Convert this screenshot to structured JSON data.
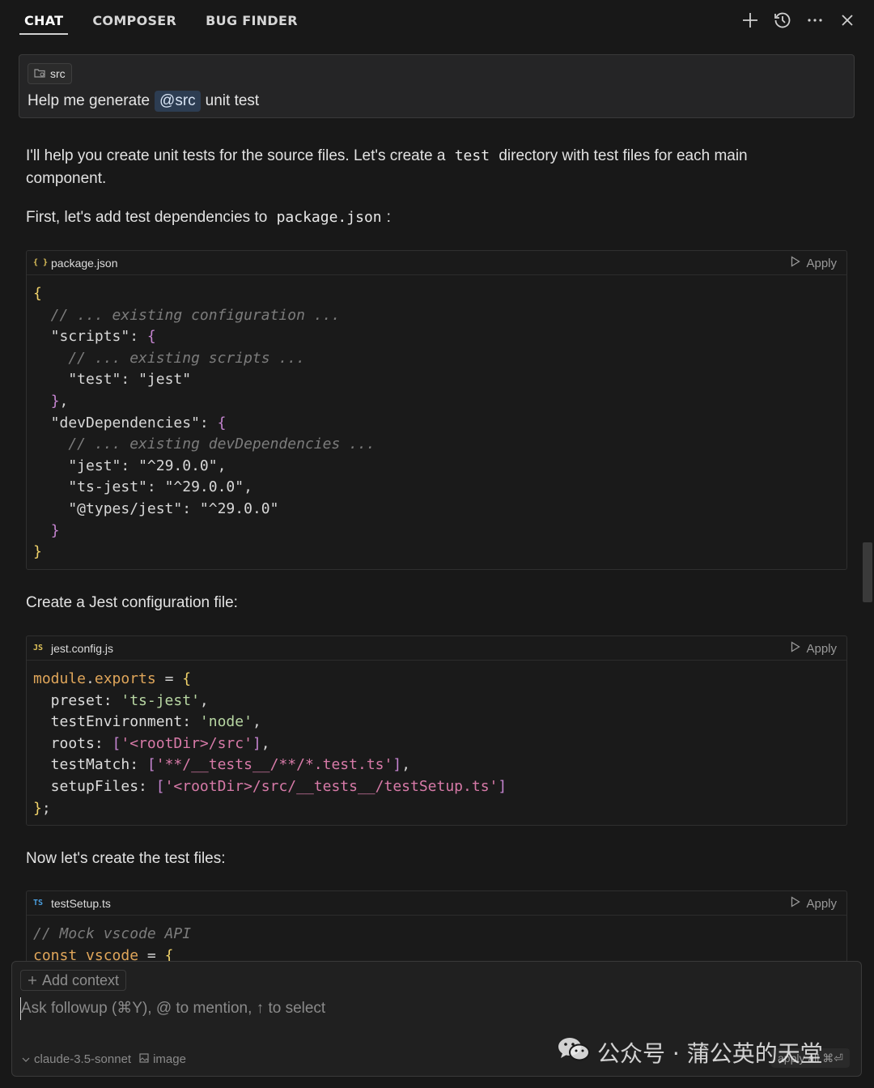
{
  "tabs": [
    {
      "label": "CHAT",
      "active": true
    },
    {
      "label": "COMPOSER",
      "active": false
    },
    {
      "label": "BUG FINDER",
      "active": false
    }
  ],
  "top_actions": [
    "plus-icon",
    "history-icon",
    "more-icon",
    "close-icon"
  ],
  "query": {
    "chip_label": "src",
    "text_before": "Help me generate",
    "mention": "@src",
    "text_after": "unit test"
  },
  "response": {
    "intro_a": "I'll help you create unit tests for the source files. Let's create a",
    "intro_code": "test",
    "intro_b": "directory with test files for each main",
    "intro_c": "component.",
    "deps_a": "First, let's add test dependencies to",
    "deps_code": "package.json",
    "deps_b": ":",
    "jest_config_label": "Create a Jest configuration file:",
    "test_files_label": "Now let's create the test files:"
  },
  "code_blocks": [
    {
      "file_icon": "{ }",
      "filename": "package.json",
      "apply_label": "Apply",
      "lines": [
        [
          [
            "{",
            "br"
          ]
        ],
        [
          [
            "  // ... existing configuration ...",
            "cm"
          ]
        ],
        [
          [
            "  \"scripts\"",
            "key"
          ],
          [
            ": ",
            "p"
          ],
          [
            "{",
            "br2"
          ]
        ],
        [
          [
            "    // ... existing scripts ...",
            "cm"
          ]
        ],
        [
          [
            "    \"test\"",
            "key"
          ],
          [
            ": ",
            "p"
          ],
          [
            "\"jest\"",
            "str"
          ]
        ],
        [
          [
            "  ",
            "p"
          ],
          [
            "}",
            "br2"
          ],
          [
            ",",
            "p"
          ]
        ],
        [
          [
            "  \"devDependencies\"",
            "key"
          ],
          [
            ": ",
            "p"
          ],
          [
            "{",
            "br2"
          ]
        ],
        [
          [
            "    // ... existing devDependencies ...",
            "cm"
          ]
        ],
        [
          [
            "    \"jest\"",
            "key"
          ],
          [
            ": ",
            "p"
          ],
          [
            "\"^29.0.0\"",
            "str"
          ],
          [
            ",",
            "p"
          ]
        ],
        [
          [
            "    \"ts-jest\"",
            "key"
          ],
          [
            ": ",
            "p"
          ],
          [
            "\"^29.0.0\"",
            "str"
          ],
          [
            ",",
            "p"
          ]
        ],
        [
          [
            "    \"@types/jest\"",
            "key"
          ],
          [
            ": ",
            "p"
          ],
          [
            "\"^29.0.0\"",
            "str"
          ]
        ],
        [
          [
            "  ",
            "p"
          ],
          [
            "}",
            "br2"
          ]
        ],
        [
          [
            "}",
            "br"
          ]
        ]
      ]
    },
    {
      "file_icon": "JS",
      "filename": "jest.config.js",
      "apply_label": "Apply",
      "lines": [
        [
          [
            "module",
            "kw"
          ],
          [
            ".",
            "p"
          ],
          [
            "exports",
            "kw"
          ],
          [
            " = ",
            "p"
          ],
          [
            "{",
            "br"
          ]
        ],
        [
          [
            "  preset: ",
            "prop"
          ],
          [
            "'ts-jest'",
            "sq"
          ],
          [
            ",",
            "p"
          ]
        ],
        [
          [
            "  testEnvironment: ",
            "prop"
          ],
          [
            "'node'",
            "sq"
          ],
          [
            ",",
            "p"
          ]
        ],
        [
          [
            "  roots: ",
            "prop"
          ],
          [
            "[",
            "br2"
          ],
          [
            "'<rootDir>/src'",
            "js"
          ],
          [
            "]",
            "br2"
          ],
          [
            ",",
            "p"
          ]
        ],
        [
          [
            "  testMatch: ",
            "prop"
          ],
          [
            "[",
            "br2"
          ],
          [
            "'**/__tests__/**/*.test.ts'",
            "js"
          ],
          [
            "]",
            "br2"
          ],
          [
            ",",
            "p"
          ]
        ],
        [
          [
            "  setupFiles: ",
            "prop"
          ],
          [
            "[",
            "br2"
          ],
          [
            "'<rootDir>/src/__tests__/testSetup.ts'",
            "js"
          ],
          [
            "]",
            "br2"
          ]
        ],
        [
          [
            "}",
            "br"
          ],
          [
            ";",
            "p"
          ]
        ]
      ]
    },
    {
      "file_icon": "TS",
      "filename": "testSetup.ts",
      "apply_label": "Apply",
      "lines": [
        [
          [
            "// Mock vscode API",
            "cm"
          ]
        ],
        [
          [
            "const ",
            "kw"
          ],
          [
            "vscode",
            "kw"
          ],
          [
            " = ",
            "p"
          ],
          [
            "{",
            "br"
          ]
        ]
      ]
    }
  ],
  "composer": {
    "add_context_label": "Add context",
    "placeholder": "Ask followup (⌘Y), @ to mention, ↑ to select",
    "model_label": "claude-3.5-sonnet",
    "image_label": "image",
    "apply_all_label": "apply all ⌘⏎"
  },
  "watermark": {
    "text": "公众号 · 蒲公英的天堂"
  }
}
